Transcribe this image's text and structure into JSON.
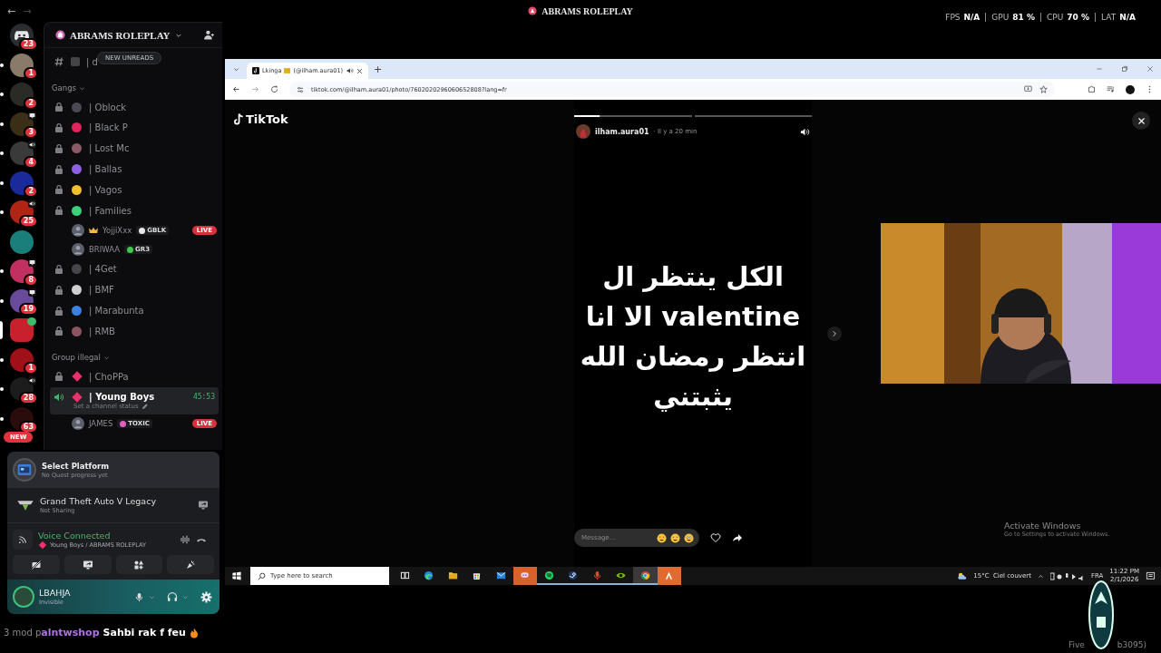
{
  "title_bar": {
    "back": "←",
    "forward": "→",
    "title": "ABRAMS ROLEPLAY",
    "stats": [
      {
        "label": "FPS",
        "value": "N/A"
      },
      {
        "label": "GPU",
        "value": "81 %"
      },
      {
        "label": "CPU",
        "value": "70 %"
      },
      {
        "label": "LAT",
        "value": "N/A"
      }
    ]
  },
  "servers": [
    {
      "kind": "home",
      "badge": "23",
      "color": "#2b2d31",
      "unread": false,
      "selected": false,
      "sharing": false,
      "voice": false
    },
    {
      "kind": "avatar",
      "badge": "1",
      "color": "#8a7a6a",
      "unread": true,
      "selected": false,
      "sharing": false,
      "voice": false
    },
    {
      "kind": "avatar",
      "badge": "2",
      "color": "#2a2a26",
      "unread": true,
      "selected": false,
      "sharing": false,
      "voice": false
    },
    {
      "kind": "avatar",
      "badge": "3",
      "color": "#3a2e16",
      "unread": true,
      "selected": false,
      "sharing": true,
      "voice": false
    },
    {
      "kind": "avatar",
      "badge": "4",
      "color": "#3a3a3a",
      "unread": true,
      "selected": false,
      "sharing": false,
      "voice": true
    },
    {
      "kind": "avatar",
      "badge": "2",
      "color": "#1b2a9a",
      "unread": true,
      "selected": false,
      "sharing": false,
      "voice": false
    },
    {
      "kind": "avatar",
      "badge": "25",
      "color": "#b02414",
      "unread": true,
      "selected": false,
      "sharing": false,
      "voice": true
    },
    {
      "kind": "avatar",
      "color": "#1a7f7a",
      "unread": false,
      "selected": false,
      "sharing": false,
      "voice": false
    },
    {
      "kind": "avatar",
      "badge": "8",
      "color": "#c03060",
      "unread": true,
      "selected": false,
      "sharing": true,
      "voice": false
    },
    {
      "kind": "avatar",
      "badge": "19",
      "color": "#6a4a9a",
      "unread": true,
      "selected": false,
      "sharing": true,
      "voice": false
    },
    {
      "kind": "avatar",
      "color": "#c8202c",
      "unread": false,
      "selected": true,
      "sharing": false,
      "voice": true
    },
    {
      "kind": "avatar",
      "badge": "1",
      "color": "#a01018",
      "unread": true,
      "selected": false,
      "sharing": false,
      "voice": false
    },
    {
      "kind": "avatar",
      "badge": "28",
      "color": "#1c1c1c",
      "unread": true,
      "selected": false,
      "sharing": false,
      "voice": true
    },
    {
      "kind": "avatar",
      "badge": "63",
      "color": "#2a0c0c",
      "unread": true,
      "selected": false,
      "sharing": false,
      "voice": false
    }
  ],
  "new_badge": "NEW",
  "channel_panel": {
    "server_name": "ABRAMS ROLEPLAY",
    "new_unreads": "NEW UNREADS",
    "cut_channel": "| d",
    "categories": [
      {
        "name": "Gangs",
        "channels": [
          {
            "name": "| Oblock",
            "kind": "locked",
            "diamond": false,
            "color": "#4a4a55",
            "selected": false
          },
          {
            "name": "| Black P",
            "kind": "locked",
            "diamond": false,
            "color": "#e0245e",
            "selected": false
          },
          {
            "name": "| Lost Mc",
            "kind": "locked",
            "diamond": false,
            "color": "#8a5a66",
            "selected": false
          },
          {
            "name": "| Ballas",
            "kind": "locked",
            "diamond": false,
            "color": "#8e5fe0",
            "selected": false
          },
          {
            "name": "| Vagos",
            "kind": "locked",
            "diamond": false,
            "color": "#f0c030",
            "selected": false
          },
          {
            "name": "| Families",
            "kind": "locked",
            "diamond": false,
            "color": "#3ecf7a",
            "selected": false,
            "users": [
              {
                "name": "YojjiXxx",
                "crown": true,
                "tag": {
                  "text": "GBLK",
                  "color": "#e8e8e8"
                },
                "live": "LIVE"
              },
              {
                "name": "BRIWAA",
                "crown": false,
                "tag": {
                  "text": "GR3",
                  "color": "#3ec94a"
                }
              }
            ]
          },
          {
            "name": "| 4Get",
            "kind": "locked",
            "diamond": false,
            "color": "#45454a",
            "selected": false
          },
          {
            "name": "| BMF",
            "kind": "locked",
            "diamond": false,
            "color": "#cfcfd2",
            "selected": false
          },
          {
            "name": "| Marabunta",
            "kind": "locked",
            "diamond": false,
            "color": "#3b82e0",
            "selected": false
          },
          {
            "name": "| RMB",
            "kind": "locked",
            "diamond": false,
            "color": "#8a5560",
            "selected": false
          }
        ]
      },
      {
        "name": "Group illegal",
        "channels": [
          {
            "name": "| ChoPPa",
            "kind": "locked",
            "diamond": true,
            "color": "#f0306a",
            "selected": false
          },
          {
            "name": "| Young Boys",
            "kind": "voice",
            "diamond": true,
            "color": "#f0306a",
            "selected": true,
            "timer": "45:53",
            "status": "Set a channel status",
            "users": [
              {
                "name": "JAMES",
                "crown": false,
                "tag": {
                  "text": "TOXIC",
                  "color": "#e060c0"
                },
                "live": "LIVE"
              }
            ]
          }
        ]
      }
    ]
  },
  "quest": {
    "title": "Select Platform",
    "subtitle": "No Quest progress yet"
  },
  "game": {
    "title": "Grand Theft Auto V Legacy",
    "subtitle": "Not Sharing"
  },
  "voice": {
    "status": "Voice Connected",
    "channel": "Young Boys / ABRAMS ROLEPLAY",
    "color": "#f0306a"
  },
  "user": {
    "name": "LBAHJA",
    "status": "Invisible"
  },
  "chat": {
    "prefix": "3 mod p",
    "author": "alntwshop",
    "message": "Sahbi rak f feu"
  },
  "browser": {
    "tab": {
      "title": "Lkinga",
      "handle": "(@ilham.aura01)"
    },
    "new_tab": "+",
    "url": "tiktok.com/@ilham.aura01/photo/7602020296060652808?lang=fr"
  },
  "tiktok": {
    "logo": "TikTok",
    "story": {
      "progress": [
        {
          "level": 0.22
        },
        {
          "level": 0
        }
      ],
      "author": "ilham.aura01",
      "time": "· Il y a 20 min",
      "text": "الكل ينتظر ال\nvalentine الا انا\nانتظر رمضان الله\nيثبتني",
      "message_placeholder": "Message..."
    }
  },
  "activation": {
    "title": "Activate Windows",
    "subtitle": "Go to Settings to activate Windows."
  },
  "taskbar": {
    "search_placeholder": "Type here to search",
    "apps": [
      {
        "kind": "taskview",
        "running": false,
        "selected": false
      },
      {
        "kind": "edge",
        "running": false,
        "selected": false
      },
      {
        "kind": "folder",
        "running": false,
        "selected": false
      },
      {
        "kind": "store",
        "running": false,
        "selected": false
      },
      {
        "kind": "mail",
        "running": false,
        "selected": false
      },
      {
        "kind": "chatapp",
        "running": false,
        "selected": false
      },
      {
        "kind": "music",
        "running": true,
        "selected": false
      },
      {
        "kind": "steam",
        "running": true,
        "selected": false
      },
      {
        "kind": "mic",
        "running": true,
        "selected": false
      },
      {
        "kind": "eye",
        "running": true,
        "selected": false
      },
      {
        "kind": "chrome",
        "running": true,
        "selected": true
      },
      {
        "kind": "arc",
        "running": false,
        "selected": false
      }
    ],
    "weather": "15°C  Ciel couvert",
    "language": "FRA",
    "time": "11:22 PM",
    "date": "2/1/2026"
  },
  "footer": {
    "left": "Five",
    "right": "b3095)"
  }
}
